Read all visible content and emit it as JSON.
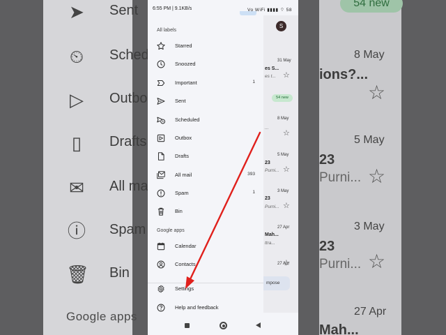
{
  "status_bar": {
    "time": "6:55 PM | 9.1KB/s",
    "icons": "Vo WiFi ▮▮▮▮ ⌔ 58"
  },
  "drawer": {
    "section_all_labels": "All labels",
    "items": [
      {
        "label": "Starred",
        "icon": "star-icon",
        "count": ""
      },
      {
        "label": "Snoozed",
        "icon": "clock-icon",
        "count": ""
      },
      {
        "label": "Important",
        "icon": "important-icon",
        "count": "1"
      },
      {
        "label": "Sent",
        "icon": "send-icon",
        "count": ""
      },
      {
        "label": "Scheduled",
        "icon": "scheduled-send-icon",
        "count": ""
      },
      {
        "label": "Outbox",
        "icon": "outbox-icon",
        "count": ""
      },
      {
        "label": "Drafts",
        "icon": "draft-icon",
        "count": ""
      },
      {
        "label": "All mail",
        "icon": "all-mail-icon",
        "count": "393"
      },
      {
        "label": "Spam",
        "icon": "spam-icon",
        "count": "1"
      },
      {
        "label": "Bin",
        "icon": "bin-icon",
        "count": ""
      }
    ],
    "section_google_apps": "Google apps",
    "google_apps": [
      {
        "label": "Calendar",
        "icon": "calendar-icon"
      },
      {
        "label": "Contacts",
        "icon": "contacts-icon"
      }
    ],
    "settings": {
      "label": "Settings",
      "icon": "gear-icon"
    },
    "help": {
      "label": "Help and feedback",
      "icon": "help-icon"
    }
  },
  "underlay": {
    "avatar_letter": "S",
    "new_badge": "54 new",
    "compose": "mpose",
    "dates": [
      "31 May",
      "8 May",
      "5 May",
      "3 May",
      "27 Apr",
      "27 Apr"
    ],
    "fragments": [
      "es S...",
      "23",
      "23",
      "...",
      "Mah..."
    ],
    "subs": [
      "es t...",
      "Purni...",
      "Purni...",
      "Purni...",
      "ttra..."
    ]
  },
  "background": {
    "left_labels": [
      "Sent",
      "Scheduled",
      "Outbox",
      "Drafts",
      "All mail",
      "Spam",
      "Bin"
    ],
    "google_apps": "Google apps",
    "right_new": "54 new",
    "right_dates": [
      "8 May",
      "5 May",
      "3 May",
      "27 Apr"
    ],
    "right_frag1": "ions?...",
    "right_frag2": "ions?...",
    "right_frag3": "23",
    "right_frag4": "23",
    "right_frag5": "Mah...",
    "right_sub1": "Purni...",
    "right_sub2": "Purni..."
  },
  "colors": {
    "arrow": "#e0201c",
    "badge_bg": "#c7e8cf",
    "badge_text": "#206b34"
  }
}
